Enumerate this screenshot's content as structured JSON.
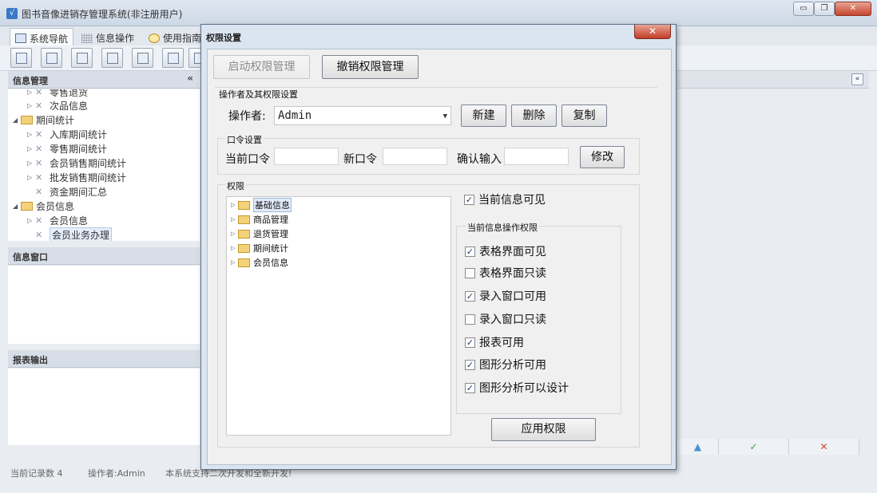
{
  "app": {
    "title": "图书音像进销存管理系统(非注册用户)",
    "min_glyph": "▭",
    "restore_glyph": "❐",
    "close_glyph": "✕"
  },
  "tabs": [
    {
      "label": "系统导航"
    },
    {
      "label": "信息操作"
    },
    {
      "label": "使用指南"
    }
  ],
  "left_panel": {
    "info_header": "信息管理",
    "collapse_glyph": "«",
    "tree": [
      {
        "label": "零售退货",
        "indent": 2
      },
      {
        "label": "次品信息",
        "indent": 2
      },
      {
        "label": "期间统计",
        "indent": 1
      },
      {
        "label": "入库期间统计",
        "indent": 2
      },
      {
        "label": "零售期间统计",
        "indent": 2
      },
      {
        "label": "会员销售期间统计",
        "indent": 2
      },
      {
        "label": "批发销售期间统计",
        "indent": 2
      },
      {
        "label": "资金期间汇总",
        "indent": 2
      },
      {
        "label": "会员信息",
        "indent": 1
      },
      {
        "label": "会员信息",
        "indent": 2
      },
      {
        "label": "会员业务办理",
        "indent": 2
      }
    ],
    "info_window_header": "信息窗口",
    "report_header": "报表输出"
  },
  "right_panel": {
    "collapse_glyph": "«",
    "bottom_buttons": [
      "▲",
      "✓",
      "✕"
    ]
  },
  "status": {
    "record_count": "当前记录数 4",
    "operator": "操作者:Admin",
    "note": "本系统支持二次开发和全新开发!"
  },
  "dialog": {
    "title": "权限设置",
    "close_glyph": "✕",
    "enable_button": "启动权限管理",
    "revoke_button": "撤销权限管理",
    "operators_group": "操作者及其权限设置",
    "operator_label": "操作者:",
    "operator_value": "Admin",
    "new_button": "新建",
    "delete_button": "删除",
    "copy_button": "复制",
    "password_group": "口令设置",
    "current_pw_label": "当前口令",
    "new_pw_label": "新口令",
    "confirm_pw_label": "确认输入",
    "modify_button": "修改",
    "permissions_group": "权限",
    "perm_tree": [
      "基础信息",
      "商品管理",
      "退货管理",
      "期间统计",
      "会员信息"
    ],
    "current_visible": {
      "label": "当前信息可见",
      "checked": true
    },
    "ops_group": "当前信息操作权限",
    "ops": [
      {
        "label": "表格界面可见",
        "checked": true
      },
      {
        "label": "表格界面只读",
        "checked": false
      },
      {
        "label": "录入窗口可用",
        "checked": true
      },
      {
        "label": "录入窗口只读",
        "checked": false
      },
      {
        "label": "报表可用",
        "checked": true
      },
      {
        "label": "图形分析可用",
        "checked": true
      },
      {
        "label": "图形分析可以设计",
        "checked": true
      }
    ],
    "apply_button": "应用权限"
  }
}
